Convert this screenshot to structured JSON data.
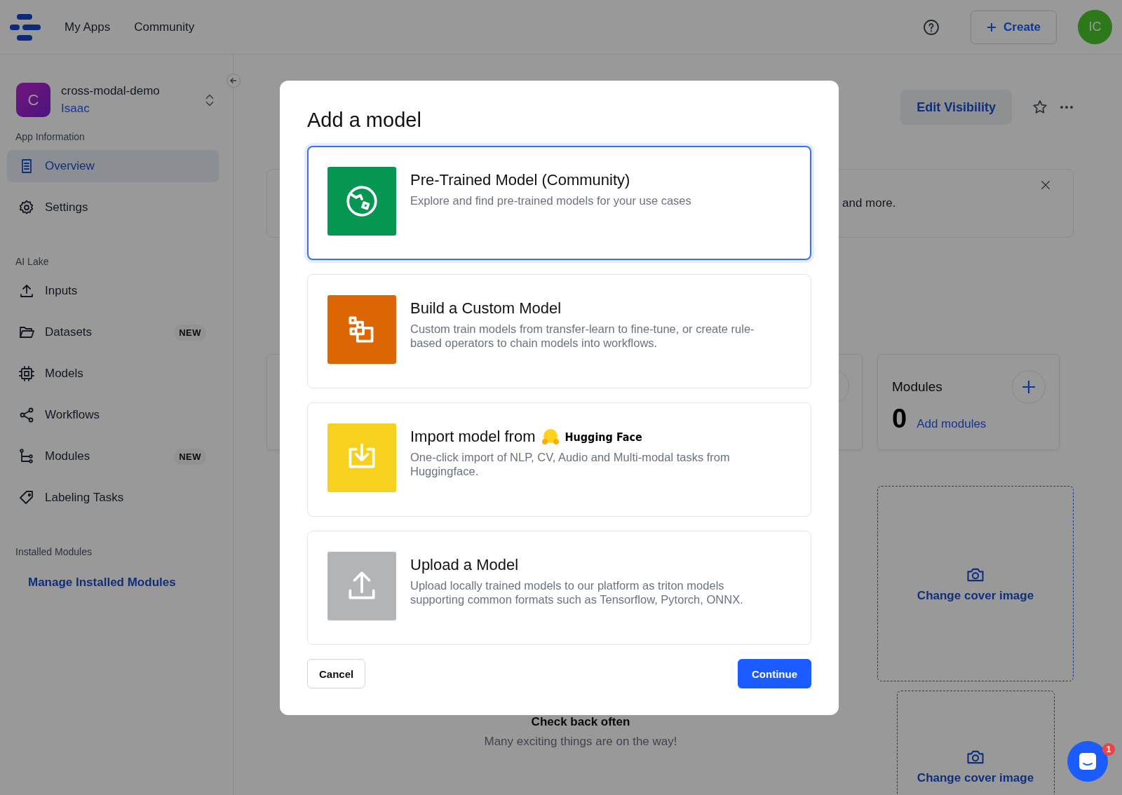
{
  "header": {
    "nav": [
      {
        "label": "My Apps"
      },
      {
        "label": "Community"
      }
    ],
    "create_button": "Create",
    "avatar": "IC"
  },
  "sidebar": {
    "app": {
      "initial": "C",
      "name": "cross-modal-demo",
      "owner": "Isaac"
    },
    "sections": [
      {
        "title": "App Information",
        "items": [
          {
            "label": "Overview",
            "selected": true
          },
          {
            "label": "Settings",
            "selected": false
          }
        ]
      },
      {
        "title": "AI Lake",
        "items": [
          {
            "label": "Inputs",
            "selected": false
          },
          {
            "label": "Datasets",
            "selected": false,
            "badge": "NEW"
          },
          {
            "label": "Models",
            "selected": false
          },
          {
            "label": "Workflows",
            "selected": false
          },
          {
            "label": "Modules",
            "selected": false,
            "badge": "NEW"
          },
          {
            "label": "Labeling Tasks",
            "selected": false
          }
        ]
      },
      {
        "title": "Installed Modules",
        "link": "Manage Installed Modules"
      }
    ]
  },
  "main": {
    "edit_visibility": "Edit Visibility",
    "banner_text": "and more.",
    "modules_card": {
      "title": "Modules",
      "count": "0",
      "link": "Add modules"
    },
    "cover_images": [
      "Change cover image",
      "Change cover image"
    ],
    "empty_state": {
      "title": "Check back often",
      "text": "Many exciting things are on the way!"
    }
  },
  "modal": {
    "title": "Add a model",
    "options": [
      {
        "title": "Pre-Trained Model (Community)",
        "description": "Explore and find pre-trained models for your use cases",
        "color": "#059652",
        "selected": true
      },
      {
        "title": "Build a Custom Model",
        "description": "Custom train models from transfer-learn to fine-tune, or create rule-based operators to chain models into workflows.",
        "color": "#dd6504",
        "selected": false
      },
      {
        "title": "Import model from",
        "brand": "Hugging Face",
        "description": "One-click import of NLP, CV, Audio and Multi-modal tasks from Huggingface.",
        "color": "#f8d11f",
        "selected": false
      },
      {
        "title": "Upload a Model",
        "description": "Upload locally trained models to our platform as triton models supporting common formats such as Tensorflow, Pytorch, ONNX.",
        "color": "#b3b4b6",
        "selected": false
      }
    ],
    "cancel": "Cancel",
    "continue": "Continue"
  },
  "chat": {
    "badge": "1"
  }
}
